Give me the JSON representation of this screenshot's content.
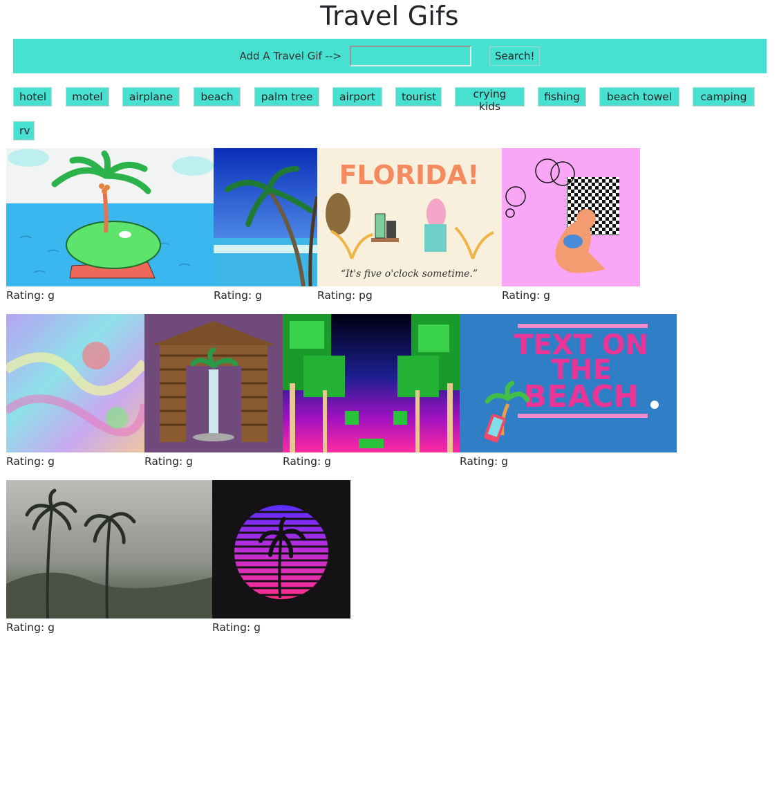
{
  "page": {
    "title": "Travel Gifs"
  },
  "search": {
    "label": "Add A Travel Gif -->",
    "value": "",
    "button_label": "Search!"
  },
  "topics": [
    "hotel",
    "motel",
    "airplane",
    "beach",
    "palm tree",
    "airport",
    "tourist",
    "crying kids",
    "fishing",
    "beach towel",
    "camping",
    "rv"
  ],
  "gifs": [
    {
      "rating": "Rating: g",
      "scene": "cartoon palm tree island in the sea"
    },
    {
      "rating": "Rating: g",
      "scene": "tropical beach with palm trees"
    },
    {
      "rating": "Rating: pg",
      "scene": "Florida cartoon illustration",
      "text": [
        "FLORIDA!",
        "“It's five o'clock sometime.”"
      ]
    },
    {
      "rating": "Rating: g",
      "scene": "3D figure with checkerboard on pink background"
    },
    {
      "rating": "Rating: g",
      "scene": "psychedelic swirling colors"
    },
    {
      "rating": "Rating: g",
      "scene": "3D hut with palm tree and waterfall"
    },
    {
      "rating": "Rating: g",
      "scene": "pixel art palm trees at neon sunset"
    },
    {
      "rating": "Rating: g",
      "scene": "beach text advertisement",
      "text": [
        "TEXT ON",
        "THE",
        "BEACH"
      ]
    },
    {
      "rating": "Rating: g",
      "scene": "palm trees in a storm"
    },
    {
      "rating": "Rating: g",
      "scene": "retrowave sunset with palm silhouette"
    }
  ],
  "colors": {
    "accent": "#46e1d0"
  }
}
